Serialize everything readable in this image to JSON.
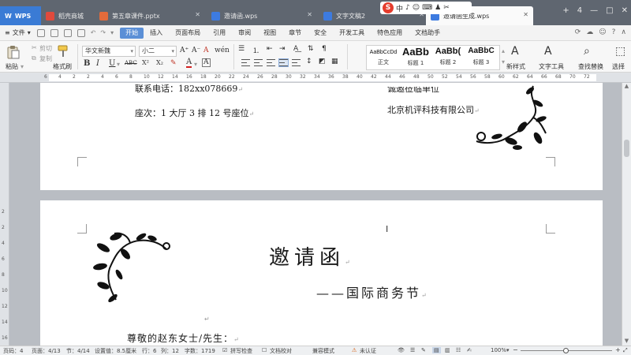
{
  "tabs": {
    "wps": "WPS",
    "items": [
      "稻壳商城",
      "第五章课件.pptx",
      "邀请函.wps",
      "文字文稿2",
      "邀请函生成.wps"
    ]
  },
  "ime": {
    "logo": "S",
    "items": [
      "中",
      "♪",
      "☺",
      "⌨",
      "♟",
      "✂"
    ]
  },
  "window": {
    "new_tab": "+",
    "counter": "4",
    "minimize": "—",
    "maximize": "□",
    "close": "✕"
  },
  "menu": {
    "file": "文件",
    "items": [
      "开始",
      "插入",
      "页面布局",
      "引用",
      "审阅",
      "视图",
      "章节",
      "安全",
      "开发工具",
      "特色应用",
      "文档助手"
    ],
    "active": "开始"
  },
  "ribbon": {
    "paste": "粘贴",
    "cut": "剪切",
    "copy": "复制",
    "format_painter": "格式刷",
    "font_name": "华文新魏",
    "font_size": "小二",
    "bold": "B",
    "italic": "I",
    "underline": "U",
    "grow": "A⁺",
    "shrink": "A⁻",
    "clear": "A",
    "strike": "ABC",
    "super": "X²",
    "sub": "X₂",
    "font_color": "A",
    "styles": [
      {
        "sample": "AaBbCcDd",
        "name": "正文"
      },
      {
        "sample": "AaBb",
        "name": "标题 1"
      },
      {
        "sample": "AaBb(",
        "name": "标题 2"
      },
      {
        "sample": "AaBbC",
        "name": "标题 3"
      }
    ],
    "new_style": "新样式",
    "text_tools": "文字工具",
    "find_replace": "查找替换",
    "select": "选择"
  },
  "ruler": {
    "numbers": [
      "6",
      "4",
      "2",
      "2",
      "4",
      "6",
      "8",
      "10",
      "12",
      "14",
      "16",
      "18",
      "20",
      "22",
      "24",
      "26",
      "28",
      "30",
      "32",
      "34",
      "36",
      "38",
      "40",
      "42",
      "44",
      "46",
      "48",
      "50",
      "52",
      "54",
      "56",
      "58",
      "60",
      "62",
      "64",
      "66",
      "68",
      "70",
      "72"
    ]
  },
  "vruler": {
    "numbers": [
      "2",
      "2",
      "4",
      "6",
      "8",
      "10",
      "12",
      "14",
      "16"
    ]
  },
  "document": {
    "page1": {
      "phone": "联系电话：182xx078669",
      "seat": "座次：1 大厅 3 排 12 号座位",
      "partial_right": "诚邀莅临单位",
      "company": "北京机评科技有限公司"
    },
    "page2": {
      "title": "邀请函",
      "subtitle": "——国际商务节",
      "salutation": "尊敬的赵东女士/先生："
    },
    "para_mark": "↵"
  },
  "status": {
    "page": "页码：4",
    "pages": "页面：4/13",
    "section": "节：4/14",
    "position": "设置值：8.5厘米",
    "row": "行：6",
    "col": "列：12",
    "words": "字数：1719",
    "spell": "拼写检查",
    "proof": "文档校对",
    "compat": "兼容模式",
    "auth": "未认证",
    "zoom": "100%",
    "zoom_level": 0.5
  }
}
